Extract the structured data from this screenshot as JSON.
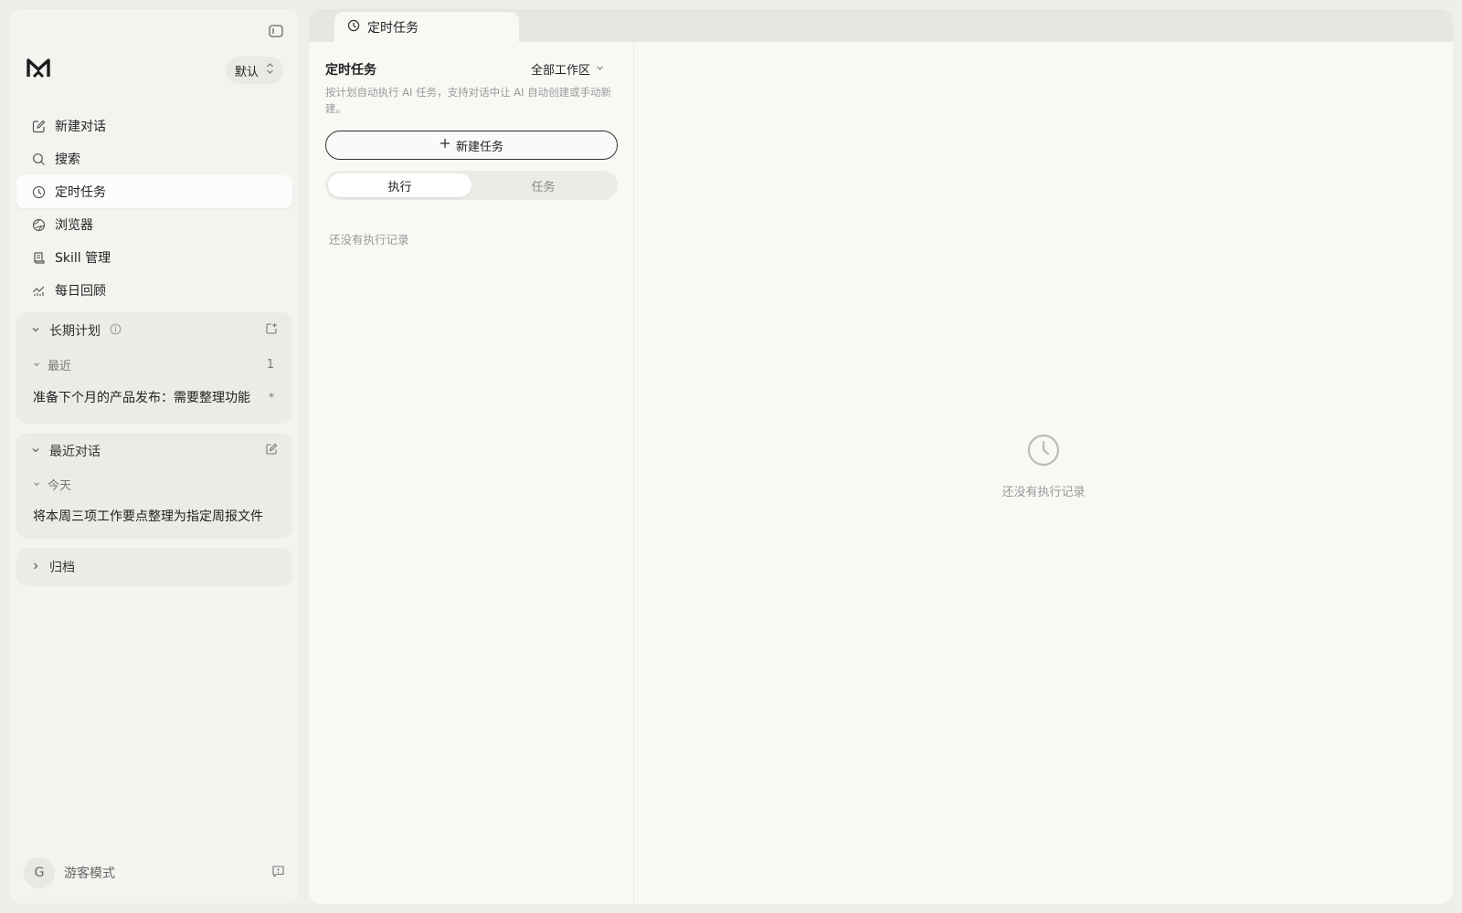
{
  "sidebar": {
    "profile": "默认",
    "nav": [
      {
        "label": "新建对话",
        "icon": "edit-icon"
      },
      {
        "label": "搜索",
        "icon": "search-icon"
      },
      {
        "label": "定时任务",
        "icon": "clock-icon"
      },
      {
        "label": "浏览器",
        "icon": "globe-icon"
      },
      {
        "label": "Skill 管理",
        "icon": "scroll-icon"
      },
      {
        "label": "每日回顾",
        "icon": "chart-icon"
      }
    ],
    "long_term": {
      "title": "长期计划",
      "subgroup": "最近",
      "count": "1",
      "item": "准备下个月的产品发布：需要整理功能",
      "item_marker": "*"
    },
    "recent": {
      "title": "最近对话",
      "subgroup": "今天",
      "item": "将本周三项工作要点整理为指定周报文件"
    },
    "archive": {
      "title": "归档"
    },
    "user": {
      "avatar": "G",
      "name": "游客模式"
    }
  },
  "main": {
    "tab": {
      "label": "定时任务"
    },
    "list": {
      "title": "定时任务",
      "workspace": "全部工作区",
      "description": "按计划自动执行 AI 任务，支持对话中让 AI 自动创建或手动新建。",
      "new_button": "新建任务",
      "segments": [
        "执行",
        "任务"
      ],
      "empty": "还没有执行记录"
    },
    "detail": {
      "empty": "还没有执行记录"
    }
  },
  "colors": {
    "background": "#f0eee9",
    "panel": "#f9f8f5",
    "sidebar": "#f4f3f0"
  }
}
